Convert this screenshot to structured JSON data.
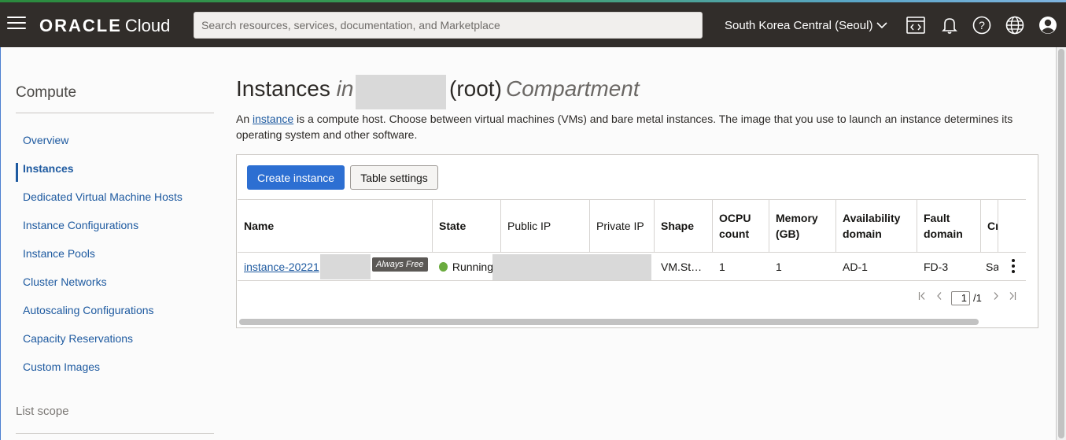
{
  "topbar": {
    "logo_brand": "ORACLE",
    "logo_product": "Cloud",
    "search_placeholder": "Search resources, services, documentation, and Marketplace",
    "region": "South Korea Central (Seoul)"
  },
  "sidebar": {
    "title": "Compute",
    "items": [
      {
        "label": "Overview"
      },
      {
        "label": "Instances",
        "active": true
      },
      {
        "label": "Dedicated Virtual Machine Hosts"
      },
      {
        "label": "Instance Configurations"
      },
      {
        "label": "Instance Pools"
      },
      {
        "label": "Cluster Networks"
      },
      {
        "label": "Autoscaling Configurations"
      },
      {
        "label": "Capacity Reservations"
      },
      {
        "label": "Custom Images"
      }
    ],
    "scope_title": "List scope"
  },
  "page": {
    "title_main": "Instances",
    "title_in": "in",
    "title_root": "(root)",
    "title_compartment": "Compartment",
    "desc_prefix": "An ",
    "desc_link": "instance",
    "desc_rest": " is a compute host. Choose between virtual machines (VMs) and bare metal instances. The image that you use to launch an instance determines its operating system and other software."
  },
  "toolbar": {
    "create_label": "Create instance",
    "settings_label": "Table settings"
  },
  "table": {
    "columns": [
      "Name",
      "State",
      "Public IP",
      "Private IP",
      "Shape",
      "OCPU count",
      "Memory (GB)",
      "Availability domain",
      "Fault domain",
      "Cr"
    ],
    "rows": [
      {
        "name": "instance-20221",
        "badge": "Always Free",
        "state": "Running",
        "shape": "VM.St…",
        "ocpu": "1",
        "memory": "1",
        "ad": "AD-1",
        "fd": "FD-3",
        "created": "Sa"
      }
    ]
  },
  "pagination": {
    "page": "1",
    "total": "/1"
  },
  "colors": {
    "topbar_bg": "#312d2a",
    "primary_button": "#2d6fd2",
    "link": "#1e5aa0",
    "running_dot": "#6aab3e"
  }
}
